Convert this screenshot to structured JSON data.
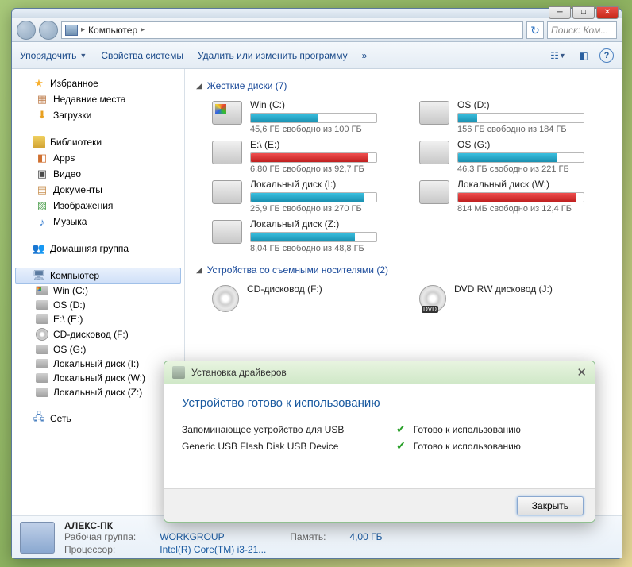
{
  "breadcrumb": {
    "root": "Компьютер"
  },
  "search": {
    "placeholder": "Поиск: Ком..."
  },
  "toolbar": {
    "organize": "Упорядочить",
    "sys_props": "Свойства системы",
    "uninstall": "Удалить или изменить программу",
    "more": "»"
  },
  "tree": {
    "favorites": {
      "label": "Избранное",
      "recent": "Недавние места",
      "downloads": "Загрузки"
    },
    "libraries": {
      "label": "Библиотеки",
      "apps": "Apps",
      "video": "Видео",
      "docs": "Документы",
      "images": "Изображения",
      "music": "Музыка"
    },
    "homegroup": "Домашняя группа",
    "computer": {
      "label": "Компьютер",
      "items": [
        {
          "label": "Win (C:)"
        },
        {
          "label": "OS (D:)"
        },
        {
          "label": "E:\\ (E:)"
        },
        {
          "label": "CD-дисковод (F:)"
        },
        {
          "label": "OS (G:)"
        },
        {
          "label": "Локальный диск (I:)"
        },
        {
          "label": "Локальный диск (W:)"
        },
        {
          "label": "Локальный диск (Z:)"
        }
      ]
    },
    "network": "Сеть"
  },
  "sections": {
    "hdd": "Жесткие диски (7)",
    "removable": "Устройства со съемными носителями (2)"
  },
  "drives": [
    {
      "name": "Win (C:)",
      "free": "45,6 ГБ свободно из 100 ГБ",
      "pct": 54,
      "red": false,
      "win": true
    },
    {
      "name": "OS (D:)",
      "free": "156 ГБ свободно из 184 ГБ",
      "pct": 15,
      "red": false,
      "win": false
    },
    {
      "name": "E:\\ (E:)",
      "free": "6,80 ГБ свободно из 92,7 ГБ",
      "pct": 93,
      "red": true,
      "win": false
    },
    {
      "name": "OS (G:)",
      "free": "46,3 ГБ свободно из 221 ГБ",
      "pct": 79,
      "red": false,
      "win": false
    },
    {
      "name": "Локальный диск (I:)",
      "free": "25,9 ГБ свободно из 270 ГБ",
      "pct": 90,
      "red": false,
      "win": false
    },
    {
      "name": "Локальный диск (W:)",
      "free": "814 МБ свободно из 12,4 ГБ",
      "pct": 94,
      "red": true,
      "win": false
    },
    {
      "name": "Локальный диск (Z:)",
      "free": "8,04 ГБ свободно из 48,8 ГБ",
      "pct": 83,
      "red": false,
      "win": false
    }
  ],
  "removable": [
    {
      "name": "CD-дисковод (F:)",
      "type": "cd"
    },
    {
      "name": "DVD RW дисковод (J:)",
      "type": "dvd"
    }
  ],
  "details": {
    "name": "АЛЕКС-ПК",
    "workgroup_lbl": "Рабочая группа:",
    "workgroup": "WORKGROUP",
    "cpu_lbl": "Процессор:",
    "cpu": "Intel(R) Core(TM) i3-21...",
    "ram_lbl": "Память:",
    "ram": "4,00 ГБ"
  },
  "popup": {
    "title": "Установка драйверов",
    "heading": "Устройство готово к использованию",
    "rows": [
      {
        "dev": "Запоминающее устройство для USB",
        "status": "Готово к использованию"
      },
      {
        "dev": "Generic USB Flash Disk USB Device",
        "status": "Готово к использованию"
      }
    ],
    "close_btn": "Закрыть"
  }
}
